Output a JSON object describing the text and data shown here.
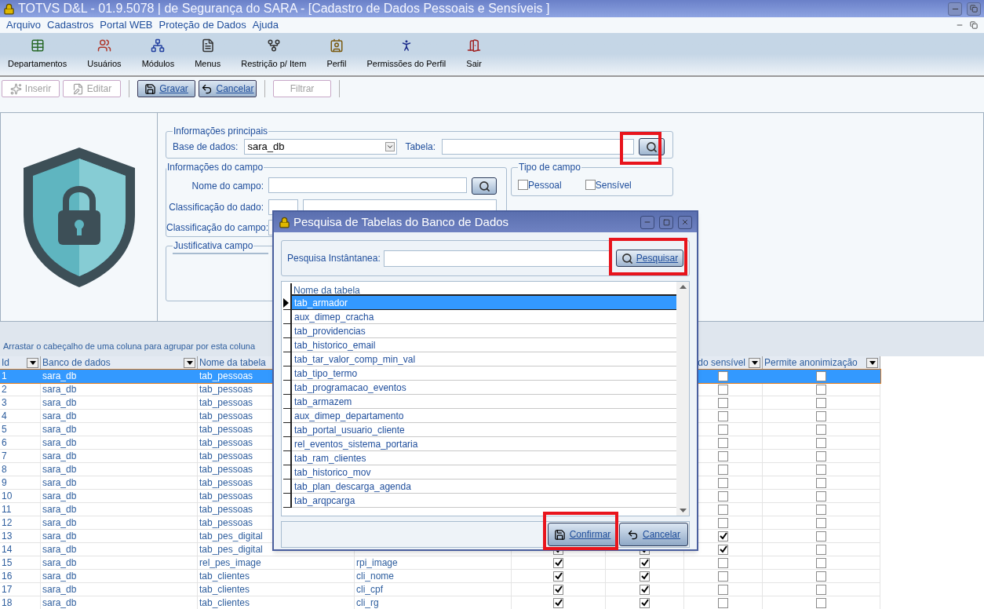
{
  "window": {
    "title": "TOTVS D&L - 01.9.5078 | de Segurança do SARA - [Cadastro de Dados Pessoais e Sensíveis ]"
  },
  "menu": [
    "Arquivo",
    "Cadastros",
    "Portal WEB",
    "Proteção de Dados",
    "Ajuda"
  ],
  "toolbar": [
    {
      "label": "Departamentos",
      "kind": "table"
    },
    {
      "label": "Usuários",
      "kind": "users"
    },
    {
      "label": "Módulos",
      "kind": "modules"
    },
    {
      "label": "Menus",
      "kind": "menus"
    },
    {
      "label": "Restrição p/ Item",
      "kind": "restriction"
    },
    {
      "label": "Perfil",
      "kind": "profile"
    },
    {
      "label": "Permissões do Perfil",
      "kind": "permissions"
    },
    {
      "label": "Sair",
      "kind": "exit"
    }
  ],
  "actions": [
    {
      "label": "Inserir",
      "kind": "insert",
      "disabled": true
    },
    {
      "label": "Editar",
      "kind": "edit",
      "disabled": true
    },
    {
      "label": "Gravar",
      "kind": "save",
      "disabled": false
    },
    {
      "label": "Cancelar",
      "kind": "cancel",
      "disabled": false
    },
    {
      "label": "Filtrar",
      "kind": "filter",
      "disabled": true
    }
  ],
  "form": {
    "main_group": {
      "title": "Informações principais",
      "database_label": "Base de dados:",
      "database_value": "sara_db",
      "table_label": "Tabela:"
    },
    "field_group": {
      "title": "Informações do campo",
      "name_label": "Nome do campo:",
      "data_class_label": "Classificação do dado:",
      "field_class_label": "Classificação do campo:"
    },
    "type_group": {
      "title": "Tipo de campo",
      "options": [
        {
          "label": "Pessoal",
          "checked": false
        },
        {
          "label": "Sensível",
          "checked": false
        }
      ]
    },
    "justification_group": {
      "title": "Justificativa campo"
    }
  },
  "grid": {
    "group_hint": "Arrastar o cabeçalho de uma coluna para agrupar por esta coluna",
    "headers": {
      "id": "Id",
      "database": "Banco de dados",
      "table": "Nome da tabela",
      "column_7": "do sensível",
      "anonymize": "Permite anonimização"
    },
    "rows": [
      {
        "id": "1",
        "database": "sara_db",
        "table": "tab_pessoas",
        "selected": true,
        "column_7": false,
        "anonymize": false
      },
      {
        "id": "2",
        "database": "sara_db",
        "table": "tab_pessoas",
        "selected": false,
        "column_7": false,
        "anonymize": false
      },
      {
        "id": "3",
        "database": "sara_db",
        "table": "tab_pessoas",
        "selected": false,
        "column_7": false,
        "anonymize": false
      },
      {
        "id": "4",
        "database": "sara_db",
        "table": "tab_pessoas",
        "selected": false,
        "column_7": false,
        "anonymize": false
      },
      {
        "id": "5",
        "database": "sara_db",
        "table": "tab_pessoas",
        "selected": false,
        "column_7": false,
        "anonymize": false
      },
      {
        "id": "6",
        "database": "sara_db",
        "table": "tab_pessoas",
        "selected": false,
        "column_7": false,
        "anonymize": false
      },
      {
        "id": "7",
        "database": "sara_db",
        "table": "tab_pessoas",
        "selected": false,
        "column_7": false,
        "anonymize": false
      },
      {
        "id": "8",
        "database": "sara_db",
        "table": "tab_pessoas",
        "selected": false,
        "column_7": false,
        "anonymize": false
      },
      {
        "id": "9",
        "database": "sara_db",
        "table": "tab_pessoas",
        "selected": false,
        "column_7": false,
        "anonymize": false
      },
      {
        "id": "10",
        "database": "sara_db",
        "table": "tab_pessoas",
        "selected": false,
        "column_7": false,
        "anonymize": false
      },
      {
        "id": "11",
        "database": "sara_db",
        "table": "tab_pessoas",
        "selected": false,
        "column_7": false,
        "anonymize": false
      },
      {
        "id": "12",
        "database": "sara_db",
        "table": "tab_pessoas",
        "selected": false,
        "column_7": false,
        "anonymize": false
      },
      {
        "id": "13",
        "database": "sara_db",
        "table": "tab_pes_digital",
        "selected": false,
        "column_7": true,
        "anonymize": false
      },
      {
        "id": "14",
        "database": "sara_db",
        "table": "tab_pes_digital",
        "selected": false,
        "column_5": true,
        "column_6": true,
        "column_7": true,
        "anonymize": false
      },
      {
        "id": "15",
        "database": "sara_db",
        "table": "rel_pes_image",
        "selected": false,
        "column_4": "rpi_image",
        "column_5": true,
        "column_6": true,
        "column_7": false,
        "anonymize": false
      },
      {
        "id": "16",
        "database": "sara_db",
        "table": "tab_clientes",
        "selected": false,
        "column_4": "cli_nome",
        "column_5": true,
        "column_6": true,
        "column_7": false,
        "anonymize": false
      },
      {
        "id": "17",
        "database": "sara_db",
        "table": "tab_clientes",
        "selected": false,
        "column_4": "cli_cpf",
        "column_5": true,
        "column_6": true,
        "column_7": false,
        "anonymize": false
      },
      {
        "id": "18",
        "database": "sara_db",
        "table": "tab_clientes",
        "selected": false,
        "column_4": "cli_rg",
        "column_5": true,
        "column_6": true,
        "column_7": false,
        "anonymize": false
      }
    ]
  },
  "dialog": {
    "title": "Pesquisa de Tabelas do Banco de Dados",
    "search_label": "Pesquisa Instântanea:",
    "search_button": "Pesquisar",
    "list_header": "Nome da tabela",
    "items": [
      {
        "label": "tab_armador",
        "selected": true
      },
      {
        "label": "aux_dimep_cracha",
        "selected": false
      },
      {
        "label": "tab_providencias",
        "selected": false
      },
      {
        "label": "tab_historico_email",
        "selected": false
      },
      {
        "label": "tab_tar_valor_comp_min_val",
        "selected": false
      },
      {
        "label": "tab_tipo_termo",
        "selected": false
      },
      {
        "label": "tab_programacao_eventos",
        "selected": false
      },
      {
        "label": "tab_armazem",
        "selected": false
      },
      {
        "label": "aux_dimep_departamento",
        "selected": false
      },
      {
        "label": "tab_portal_usuario_cliente",
        "selected": false
      },
      {
        "label": "rel_eventos_sistema_portaria",
        "selected": false
      },
      {
        "label": "tab_ram_clientes",
        "selected": false
      },
      {
        "label": "tab_historico_mov",
        "selected": false
      },
      {
        "label": "tab_plan_descarga_agenda",
        "selected": false
      },
      {
        "label": "tab_arqpcarga",
        "selected": false
      }
    ],
    "buttons": [
      {
        "label": "Confirmar",
        "kind": "confirm"
      },
      {
        "label": "Cancelar",
        "kind": "cancel"
      }
    ]
  }
}
